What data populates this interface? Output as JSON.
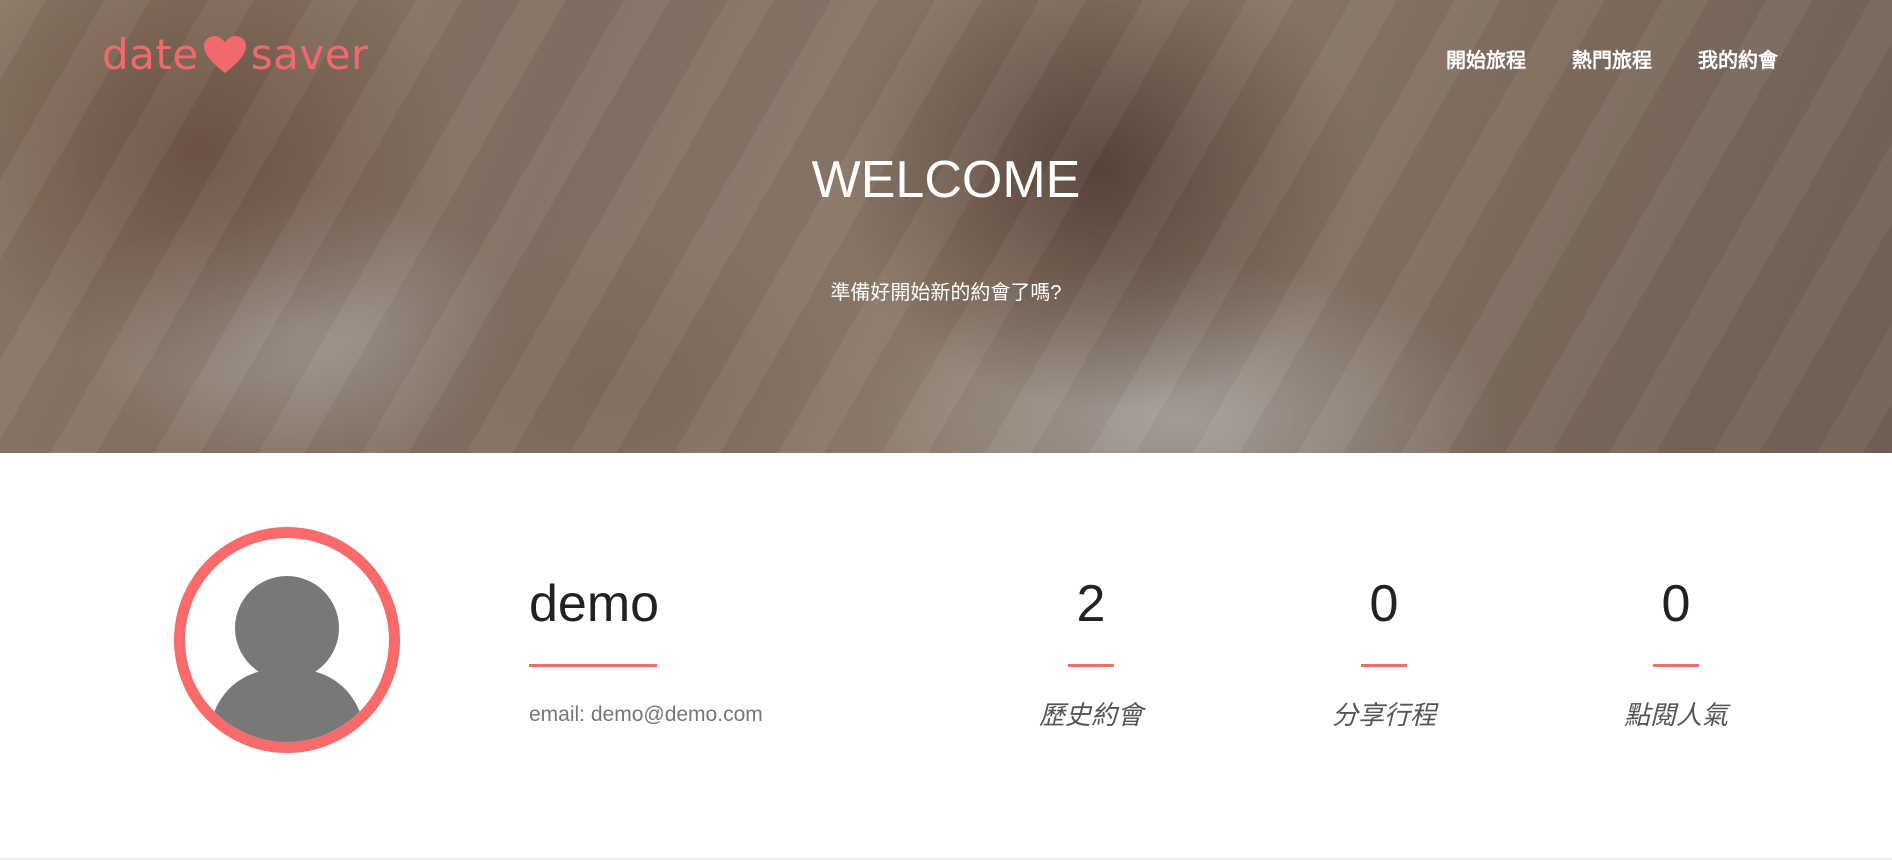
{
  "brand": {
    "part1": "date",
    "part2": "saver",
    "color": "#f2696b"
  },
  "nav": {
    "items": [
      "開始旅程",
      "熱門旅程",
      "我的約會"
    ]
  },
  "hero": {
    "title": "WELCOME",
    "subtitle": "準備好開始新的約會了嗎?"
  },
  "profile": {
    "username": "demo",
    "email": "email: demo@demo.com",
    "stats": [
      {
        "value": "2",
        "label": "歷史約會"
      },
      {
        "value": "0",
        "label": "分享行程"
      },
      {
        "value": "0",
        "label": "點閱人氣"
      }
    ]
  },
  "colors": {
    "accent": "#f86b6a"
  }
}
